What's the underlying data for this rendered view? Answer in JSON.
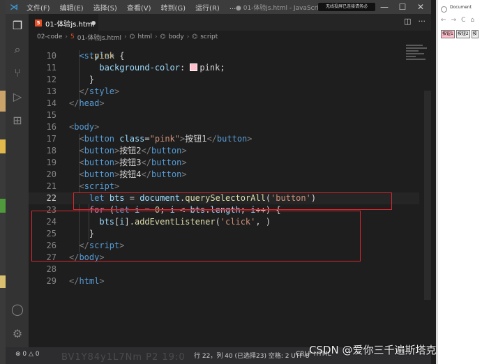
{
  "colors": {
    "accent": "#d9272f",
    "pink": "pink"
  },
  "titlebar": {
    "menu": [
      "文件(F)",
      "编辑(E)",
      "选择(S)",
      "查看(V)",
      "转到(G)",
      "运行(R)",
      "..."
    ],
    "window_title": "● 01-体验js.html - JavaScript基础 - 第...",
    "notice": "无线投屏已连接请务必",
    "minimize": "—",
    "maximize": "☐",
    "close": "✕"
  },
  "tab": {
    "icon": "html5-icon",
    "label": "01-体验js.html",
    "modified": "●"
  },
  "breadcrumb": [
    "02-code",
    "01-体验js.html",
    "html",
    "body",
    "script"
  ],
  "code_lines": [
    {
      "n": "10",
      "tokens": [
        [
          "t-text",
          "    "
        ],
        [
          "t-sel",
          ".pink"
        ],
        [
          "t-text",
          " {"
        ]
      ]
    },
    {
      "n": "11",
      "tokens": [
        [
          "t-text",
          "      "
        ],
        [
          "t-prop",
          "background-color"
        ],
        [
          "t-text",
          ": "
        ],
        [
          "swatch",
          ""
        ],
        [
          "t-val",
          "pink"
        ],
        [
          "t-text",
          ";"
        ]
      ]
    },
    {
      "n": "12",
      "tokens": [
        [
          "t-text",
          "    }"
        ]
      ]
    },
    {
      "n": "13",
      "tokens": [
        [
          "t-text",
          "  "
        ],
        [
          "t-punc",
          "</"
        ],
        [
          "t-tag",
          "style"
        ],
        [
          "t-punc",
          ">"
        ]
      ]
    },
    {
      "n": "14",
      "tokens": [
        [
          "t-punc",
          "</"
        ],
        [
          "t-tag",
          "head"
        ],
        [
          "t-punc",
          ">"
        ]
      ]
    },
    {
      "n": "15",
      "tokens": []
    },
    {
      "n": "16",
      "tokens": [
        [
          "t-punc",
          "<"
        ],
        [
          "t-tag",
          "body"
        ],
        [
          "t-punc",
          ">"
        ]
      ]
    },
    {
      "n": "17",
      "tokens": [
        [
          "t-text",
          "  "
        ],
        [
          "t-punc",
          "<"
        ],
        [
          "t-tag",
          "button"
        ],
        [
          "t-text",
          " "
        ],
        [
          "t-attr",
          "class"
        ],
        [
          "t-text",
          "="
        ],
        [
          "t-str",
          "\"pink\""
        ],
        [
          "t-punc",
          ">"
        ],
        [
          "t-text",
          "按钮1"
        ],
        [
          "t-punc",
          "</"
        ],
        [
          "t-tag",
          "button"
        ],
        [
          "t-punc",
          ">"
        ]
      ]
    },
    {
      "n": "18",
      "tokens": [
        [
          "t-text",
          "  "
        ],
        [
          "t-punc",
          "<"
        ],
        [
          "t-tag",
          "button"
        ],
        [
          "t-punc",
          ">"
        ],
        [
          "t-text",
          "按钮2"
        ],
        [
          "t-punc",
          "</"
        ],
        [
          "t-tag",
          "button"
        ],
        [
          "t-punc",
          ">"
        ]
      ]
    },
    {
      "n": "19",
      "tokens": [
        [
          "t-text",
          "  "
        ],
        [
          "t-punc",
          "<"
        ],
        [
          "t-tag",
          "button"
        ],
        [
          "t-punc",
          ">"
        ],
        [
          "t-text",
          "按钮3"
        ],
        [
          "t-punc",
          "</"
        ],
        [
          "t-tag",
          "button"
        ],
        [
          "t-punc",
          ">"
        ]
      ]
    },
    {
      "n": "20",
      "tokens": [
        [
          "t-text",
          "  "
        ],
        [
          "t-punc",
          "<"
        ],
        [
          "t-tag",
          "button"
        ],
        [
          "t-punc",
          ">"
        ],
        [
          "t-text",
          "按钮4"
        ],
        [
          "t-punc",
          "</"
        ],
        [
          "t-tag",
          "button"
        ],
        [
          "t-punc",
          ">"
        ]
      ]
    },
    {
      "n": "21",
      "tokens": [
        [
          "t-text",
          "  "
        ],
        [
          "t-punc",
          "<"
        ],
        [
          "t-tag",
          "script"
        ],
        [
          "t-punc",
          ">"
        ]
      ]
    },
    {
      "n": "22",
      "current": true,
      "tokens": [
        [
          "t-text",
          "    "
        ],
        [
          "t-kw",
          "let"
        ],
        [
          "t-text",
          " "
        ],
        [
          "t-var",
          "bts"
        ],
        [
          "t-text",
          " = "
        ],
        [
          "t-var",
          "document"
        ],
        [
          "t-text",
          "."
        ],
        [
          "t-fn",
          "querySelectorAll"
        ],
        [
          "t-text",
          "("
        ],
        [
          "t-str",
          "'button'"
        ],
        [
          "t-text",
          ")"
        ]
      ]
    },
    {
      "n": "23",
      "tokens": [
        [
          "t-text",
          "    "
        ],
        [
          "t-ctrl",
          "for"
        ],
        [
          "t-text",
          " ("
        ],
        [
          "t-kw",
          "let"
        ],
        [
          "t-text",
          " "
        ],
        [
          "t-var",
          "i"
        ],
        [
          "t-text",
          " = "
        ],
        [
          "t-num",
          "0"
        ],
        [
          "t-text",
          "; "
        ],
        [
          "t-var",
          "i"
        ],
        [
          "t-text",
          " < "
        ],
        [
          "t-var",
          "bts"
        ],
        [
          "t-text",
          "."
        ],
        [
          "t-var",
          "length"
        ],
        [
          "t-text",
          "; "
        ],
        [
          "t-var",
          "i"
        ],
        [
          "t-text",
          "++) {"
        ]
      ]
    },
    {
      "n": "24",
      "tokens": [
        [
          "t-text",
          "      "
        ],
        [
          "t-var",
          "bts"
        ],
        [
          "t-text",
          "["
        ],
        [
          "t-var",
          "i"
        ],
        [
          "t-text",
          "]."
        ],
        [
          "t-fn",
          "addEventListener"
        ],
        [
          "t-text",
          "("
        ],
        [
          "t-str",
          "'click'"
        ],
        [
          "t-text",
          ", )"
        ]
      ]
    },
    {
      "n": "25",
      "tokens": [
        [
          "t-text",
          "    }"
        ]
      ]
    },
    {
      "n": "26",
      "tokens": [
        [
          "t-text",
          "  "
        ],
        [
          "t-punc",
          "</"
        ],
        [
          "t-tag",
          "script"
        ],
        [
          "t-punc",
          ">"
        ]
      ]
    },
    {
      "n": "27",
      "tokens": [
        [
          "t-punc",
          "</"
        ],
        [
          "t-tag",
          "body"
        ],
        [
          "t-punc",
          ">"
        ]
      ]
    },
    {
      "n": "28",
      "tokens": []
    },
    {
      "n": "29",
      "tokens": [
        [
          "t-punc",
          "</"
        ],
        [
          "t-tag",
          "html"
        ],
        [
          "t-punc",
          ">"
        ]
      ]
    }
  ],
  "top_partial": "  <style>",
  "statusbar": {
    "left": "⊗ 0 △ 0",
    "right": "行 22，列 40 (已选择23)    空格: 2    UTF-8",
    "extra": "CRLF  HTML"
  },
  "watermark": "CSDN @爱你三千遍斯塔克",
  "faint_text": "BV1Y84y1L7Nm P2 19:0",
  "browser": {
    "tab_title": "Document",
    "nav": [
      "←",
      "→",
      "C",
      "⌂"
    ],
    "buttons": [
      "按钮1",
      "按钮2",
      "按"
    ]
  }
}
